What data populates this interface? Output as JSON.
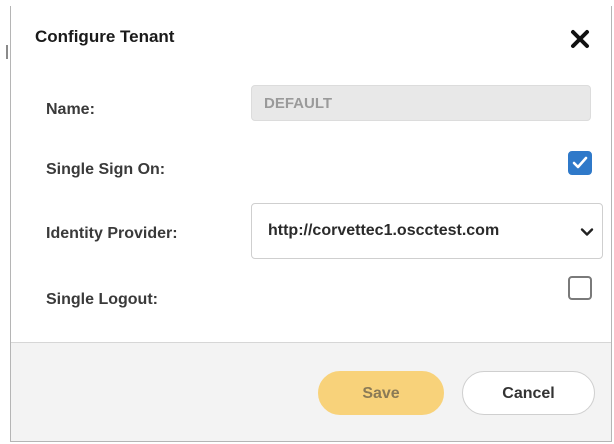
{
  "dialog": {
    "title": "Configure Tenant",
    "close_icon": "close-icon"
  },
  "fields": {
    "name": {
      "label": "Name:",
      "value": "DEFAULT",
      "disabled": true
    },
    "single_sign_on": {
      "label": "Single Sign On:",
      "checked": true
    },
    "identity_provider": {
      "label": "Identity Provider:",
      "selected": "http://corvettec1.oscctest.com",
      "icon": "chevron-down-icon"
    },
    "single_logout": {
      "label": "Single Logout:",
      "checked": false
    }
  },
  "footer": {
    "save_label": "Save",
    "cancel_label": "Cancel"
  },
  "colors": {
    "accent_checkbox": "#2f79c9",
    "save_button": "#f8d27a",
    "footer_background": "#f3f3f3",
    "disabled_field": "#e8e8e8"
  }
}
